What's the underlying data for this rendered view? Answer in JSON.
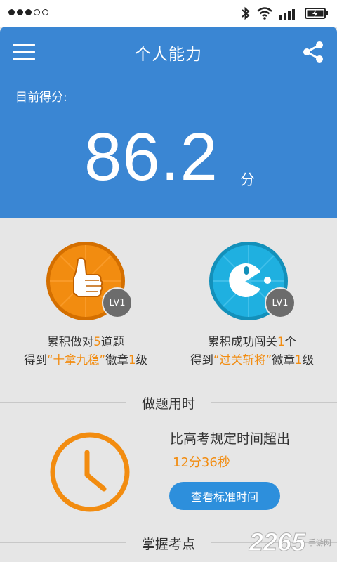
{
  "header": {
    "title": "个人能力",
    "score_label": "目前得分:",
    "score_value": "86.2",
    "score_unit": "分"
  },
  "badges": [
    {
      "icon": "thumbs-up-icon",
      "level": "LV1",
      "line1_pre": "累积做对",
      "line1_hl": "5",
      "line1_post": "道题",
      "line2_pre": "得到",
      "line2_hl": "“十拿九稳”",
      "line2_mid": "徽章",
      "line2_hl2": "1",
      "line2_post": "级"
    },
    {
      "icon": "pacman-icon",
      "level": "LV1",
      "line1_pre": "累积成功闯关",
      "line1_hl": "1",
      "line1_post": "个",
      "line2_pre": "得到",
      "line2_hl": "“过关斩将”",
      "line2_mid": "徽章",
      "line2_hl2": "1",
      "line2_post": "级"
    }
  ],
  "time_section": {
    "title": "做题用时",
    "exceed_label": "比高考规定时间超出",
    "exceed_time": "12分36秒",
    "button_label": "查看标准时间"
  },
  "points_section": {
    "title": "掌握考点"
  },
  "watermark": {
    "number": "2265",
    "text": "手游网"
  },
  "colors": {
    "header_blue": "#3a86d3",
    "accent_orange": "#f28c10",
    "badge_blue": "#1fb0e0",
    "button_blue": "#2d8fdc"
  }
}
